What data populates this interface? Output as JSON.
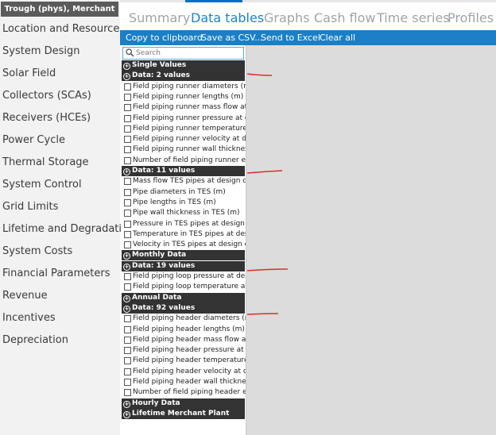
{
  "sidebar": {
    "config_label": "Trough (phys), Merchant",
    "items": [
      {
        "label": "Location and Resource"
      },
      {
        "label": "System Design"
      },
      {
        "label": "Solar Field"
      },
      {
        "label": "Collectors (SCAs)"
      },
      {
        "label": "Receivers (HCEs)"
      },
      {
        "label": "Power Cycle"
      },
      {
        "label": "Thermal Storage"
      },
      {
        "label": "System Control"
      },
      {
        "label": "Grid Limits"
      },
      {
        "label": "Lifetime and Degradation"
      },
      {
        "label": "System Costs"
      },
      {
        "label": "Financial Parameters"
      },
      {
        "label": "Revenue"
      },
      {
        "label": "Incentives"
      },
      {
        "label": "Depreciation"
      }
    ]
  },
  "tabs": [
    {
      "label": "Summary",
      "active": false
    },
    {
      "label": "Data tables",
      "active": true
    },
    {
      "label": "Graphs",
      "active": false
    },
    {
      "label": "Cash flow",
      "active": false
    },
    {
      "label": "Time series",
      "active": false
    },
    {
      "label": "Profiles",
      "active": false
    }
  ],
  "toolbar": {
    "copy_label": "Copy to clipboard",
    "csv_label": "Save as CSV...",
    "excel_label": "Send to Excel",
    "clear_label": "Clear all"
  },
  "search": {
    "placeholder": "Search",
    "value": ""
  },
  "tree": [
    {
      "type": "group",
      "label": "Single Values"
    },
    {
      "type": "group",
      "label": "Data: 2 values"
    },
    {
      "type": "item",
      "label": "Field piping runner diameters (m)"
    },
    {
      "type": "item",
      "label": "Field piping runner lengths (m)"
    },
    {
      "type": "item",
      "label": "Field piping runner mass flow at design (kg/s)"
    },
    {
      "type": "item",
      "label": "Field piping runner pressure at design (bar)"
    },
    {
      "type": "item",
      "label": "Field piping runner temperature at design (C)"
    },
    {
      "type": "item",
      "label": "Field piping runner velocity at design (m/s)"
    },
    {
      "type": "item",
      "label": "Field piping runner wall thicknesses (m)"
    },
    {
      "type": "item",
      "label": "Number of field piping runner expansions"
    },
    {
      "type": "group",
      "label": "Data: 11 values"
    },
    {
      "type": "item",
      "label": "Mass flow TES pipes at design conditions"
    },
    {
      "type": "item",
      "label": "Pipe diameters in TES (m)"
    },
    {
      "type": "item",
      "label": "Pipe lengths in TES (m)"
    },
    {
      "type": "item",
      "label": "Pipe wall thickness in TES (m)"
    },
    {
      "type": "item",
      "label": "Pressure in TES pipes at design conditions"
    },
    {
      "type": "item",
      "label": "Temperature in TES pipes at design conditions"
    },
    {
      "type": "item",
      "label": "Velocity in TES pipes at design conditions"
    },
    {
      "type": "group",
      "label": "Monthly Data"
    },
    {
      "type": "group",
      "label": "Data: 19 values"
    },
    {
      "type": "item",
      "label": "Field piping loop pressure at design (bar)"
    },
    {
      "type": "item",
      "label": "Field piping loop temperature at design (C)"
    },
    {
      "type": "group",
      "label": "Annual Data"
    },
    {
      "type": "group",
      "label": "Data: 92 values"
    },
    {
      "type": "item",
      "label": "Field piping header diameters (m)"
    },
    {
      "type": "item",
      "label": "Field piping header lengths (m)"
    },
    {
      "type": "item",
      "label": "Field piping header mass flow at design (kg/s)"
    },
    {
      "type": "item",
      "label": "Field piping header pressure at design (bar)"
    },
    {
      "type": "item",
      "label": "Field piping header temperature at design (C)"
    },
    {
      "type": "item",
      "label": "Field piping header velocity at design (m/s)"
    },
    {
      "type": "item",
      "label": "Field piping header wall thicknesses (m)"
    },
    {
      "type": "item",
      "label": "Number of field piping header expansions"
    },
    {
      "type": "group",
      "label": "Hourly Data"
    },
    {
      "type": "group",
      "label": "Lifetime Merchant Plant"
    }
  ],
  "colors": {
    "toolbar": "#1b7fc6",
    "active_tab": "#1f82c8",
    "inactive_tab": "#9ea4ab",
    "group_header": "#333333",
    "annotation": "#d9302a",
    "content_bg": "#dcdcdc"
  },
  "icons": {
    "search": "search-icon",
    "group_toggle": "expand-toggle-icon",
    "checkbox": "checkbox-icon"
  }
}
